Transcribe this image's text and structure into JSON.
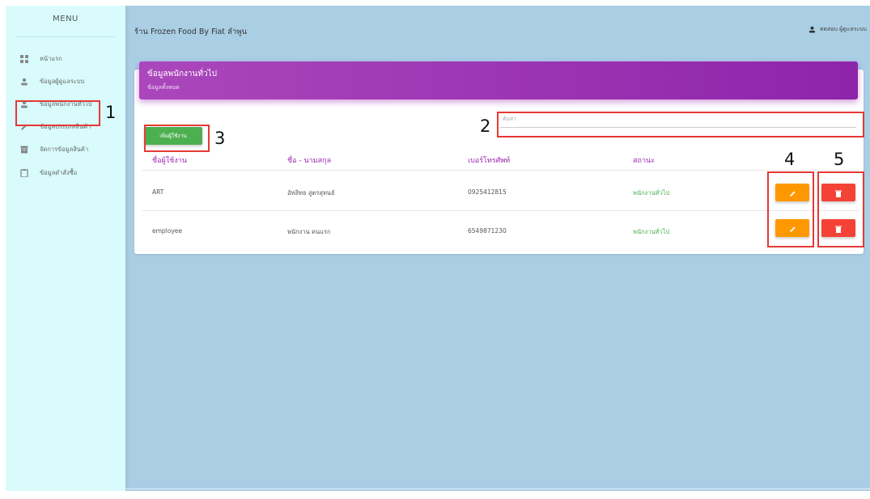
{
  "sidebar": {
    "title": "MENU",
    "items": [
      {
        "label": "หน้าแรก",
        "icon": "dashboard-icon"
      },
      {
        "label": "ข้อมูลผู้ดูแลระบบ",
        "icon": "person-icon"
      },
      {
        "label": "ข้อมูลพนักงานทั่วไป",
        "icon": "person-icon"
      },
      {
        "label": "ข้อมูลประเภทสินค้า",
        "icon": "pencil-icon"
      },
      {
        "label": "จัดการข้อมูลสินค้า",
        "icon": "archive-icon"
      },
      {
        "label": "ข้อมูลคำสั่งซื้อ",
        "icon": "clipboard-icon"
      }
    ]
  },
  "topbar": {
    "shop_title": "ร้าน Frozen Food By Fiat ลำพูน",
    "user_label": "ทดสอบ ผู้ดูแลระบบ"
  },
  "card": {
    "title": "ข้อมูลพนักงานทั่วไป",
    "subtitle": "ข้อมูลทั้งหมด",
    "search_placeholder": "ค้นหา",
    "add_button": "เพิ่มผู้ใช้งาน",
    "columns": [
      "ชื่อผู้ใช้งาน",
      "ชื่อ - นามสกุล",
      "เบอร์โทรศัพท์",
      "สถานะ"
    ],
    "rows": [
      {
        "username": "ART",
        "fullname": "อัทสิทธ สูตรสุทนธ์",
        "phone": "0925412815",
        "status": "พนักงานทั่วไป"
      },
      {
        "username": "employee",
        "fullname": "พนักงาน คนแรก",
        "phone": "6549871230",
        "status": "พนักงานทั่วไป"
      }
    ]
  },
  "annotations": [
    "1",
    "2",
    "3",
    "4",
    "5"
  ],
  "colors": {
    "background": "#aacfe5",
    "sidebar": "#d9fbfb",
    "header_gradient_start": "#ab47bc",
    "header_gradient_end": "#8e24aa",
    "add_button": "#4caf50",
    "edit_button": "#ff9800",
    "delete_button": "#f44336",
    "annotation": "#e53935"
  }
}
